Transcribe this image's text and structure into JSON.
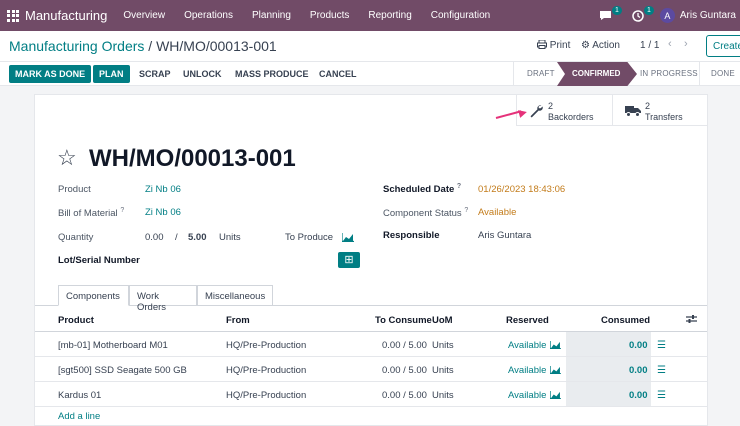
{
  "nav": {
    "brand": "Manufacturing",
    "items": [
      "Overview",
      "Operations",
      "Planning",
      "Products",
      "Reporting",
      "Configuration"
    ],
    "chat_badge": "1",
    "activity_badge": "1",
    "avatar_letter": "A",
    "user": "Aris Guntara"
  },
  "control": {
    "breadcrumb_parent": "Manufacturing Orders",
    "breadcrumb_sep": " / ",
    "breadcrumb_current": "WH/MO/00013-001",
    "print_label": "Print",
    "action_label": "Action",
    "pager": "1 / 1",
    "create_label": "Create"
  },
  "actions": {
    "mark_done": "MARK AS DONE",
    "plan": "PLAN",
    "scrap": "SCRAP",
    "unlock": "UNLOCK",
    "mass_produce": "MASS PRODUCE",
    "cancel": "CANCEL"
  },
  "stages": {
    "draft": "DRAFT",
    "confirmed": "CONFIRMED",
    "in_progress": "IN PROGRESS",
    "done": "DONE"
  },
  "smart_buttons": {
    "backorders_count": "2",
    "backorders_label": "Backorders",
    "transfers_count": "2",
    "transfers_label": "Transfers"
  },
  "record": {
    "title": "WH/MO/00013-001",
    "product_label": "Product",
    "product": "Zi Nb 06",
    "bom_label": "Bill of Material",
    "bom": "Zi Nb 06",
    "quantity_label": "Quantity",
    "quantity_done": "0.00",
    "quantity_sep": "/",
    "quantity_total": "5.00",
    "quantity_uom": "Units",
    "to_produce_label": "To Produce",
    "lot_label": "Lot/Serial Number",
    "scheduled_label": "Scheduled Date",
    "scheduled": "01/26/2023 18:43:06",
    "component_status_label": "Component Status",
    "component_status": "Available",
    "responsible_label": "Responsible",
    "responsible": "Aris Guntara",
    "help_mark": "?"
  },
  "tabs": [
    "Components",
    "Work Orders",
    "Miscellaneous"
  ],
  "table": {
    "headers": [
      "Product",
      "From",
      "To Consume",
      "UoM",
      "Reserved",
      "Consumed"
    ],
    "rows": [
      {
        "product": "[mb-01] Motherboard M01",
        "from": "HQ/Pre-Production",
        "to_consume": "0.00 /  5.00",
        "uom": "Units",
        "reserved": "Available",
        "consumed": "0.00"
      },
      {
        "product": "[sgt500] SSD Seagate 500 GB",
        "from": "HQ/Pre-Production",
        "to_consume": "0.00 /  5.00",
        "uom": "Units",
        "reserved": "Available",
        "consumed": "0.00"
      },
      {
        "product": "Kardus 01",
        "from": "HQ/Pre-Production",
        "to_consume": "0.00 /  5.00",
        "uom": "Units",
        "reserved": "Available",
        "consumed": "0.00"
      }
    ],
    "add_line": "Add a line"
  },
  "colors": {
    "brand": "#714b67",
    "accent": "#017e84",
    "warning": "#c37c1b",
    "annotation_arrow": "#e5327a"
  }
}
